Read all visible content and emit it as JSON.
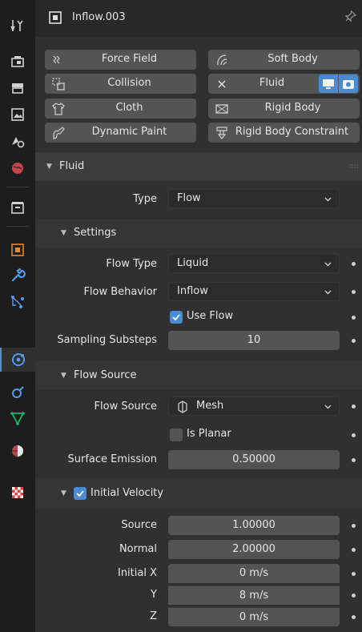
{
  "object": {
    "name": "Inflow.003"
  },
  "physics_buttons": [
    {
      "label": "Force Field",
      "icon": "force-field-icon"
    },
    {
      "label": "Soft Body",
      "icon": "soft-body-icon"
    },
    {
      "label": "Collision",
      "icon": "collision-icon"
    },
    {
      "label": "Fluid",
      "icon": "close-icon"
    },
    {
      "label": "Cloth",
      "icon": "cloth-icon"
    },
    {
      "label": "Rigid Body",
      "icon": "rigid-body-icon"
    },
    {
      "label": "Dynamic Paint",
      "icon": "dynamic-paint-icon"
    },
    {
      "label": "Rigid Body Constraint",
      "icon": "rigid-body-constraint-icon"
    }
  ],
  "fluid": {
    "section_label": "Fluid",
    "type_label": "Type",
    "type_value": "Flow",
    "settings": {
      "label": "Settings",
      "flow_type_label": "Flow Type",
      "flow_type_value": "Liquid",
      "flow_behavior_label": "Flow Behavior",
      "flow_behavior_value": "Inflow",
      "use_flow_label": "Use Flow",
      "use_flow_checked": true,
      "sampling_label": "Sampling Substeps",
      "sampling_value": "10"
    },
    "flow_source": {
      "label": "Flow Source",
      "source_label": "Flow Source",
      "source_value": "Mesh",
      "is_planar_label": "Is Planar",
      "is_planar_checked": false,
      "surface_emission_label": "Surface Emission",
      "surface_emission_value": "0.50000"
    },
    "initial_velocity": {
      "label": "Initial Velocity",
      "enabled": true,
      "source_label": "Source",
      "source_value": "1.00000",
      "normal_label": "Normal",
      "normal_value": "2.00000",
      "initial_x_label": "Initial X",
      "initial_x_value": "0 m/s",
      "y_label": "Y",
      "y_value": "8 m/s",
      "z_label": "Z",
      "z_value": "0 m/s"
    }
  },
  "colors": {
    "accent": "#4a8ad0",
    "active_tab": "#3f8fd8"
  }
}
